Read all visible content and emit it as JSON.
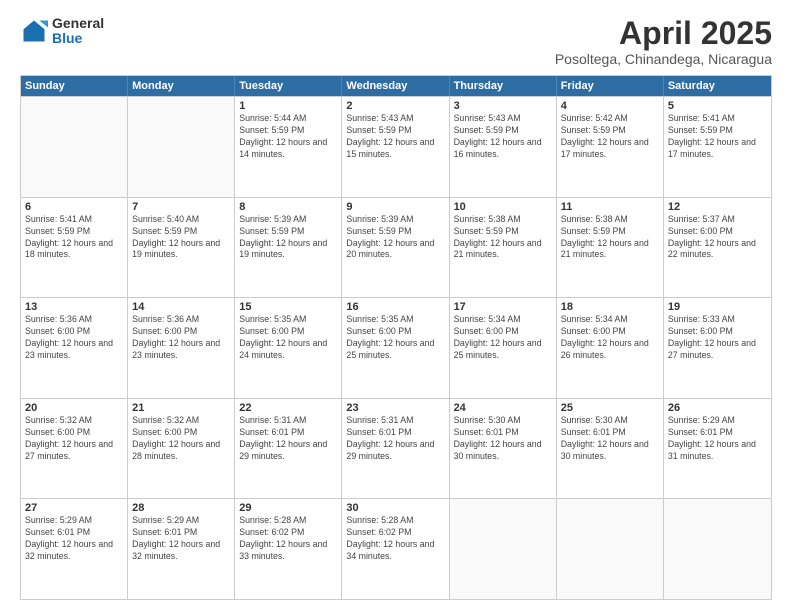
{
  "logo": {
    "general": "General",
    "blue": "Blue"
  },
  "header": {
    "month": "April 2025",
    "location": "Posoltega, Chinandega, Nicaragua"
  },
  "days_of_week": [
    "Sunday",
    "Monday",
    "Tuesday",
    "Wednesday",
    "Thursday",
    "Friday",
    "Saturday"
  ],
  "weeks": [
    [
      {
        "day": "",
        "empty": true
      },
      {
        "day": "",
        "empty": true
      },
      {
        "day": "1",
        "sunrise": "5:44 AM",
        "sunset": "5:59 PM",
        "daylight": "12 hours and 14 minutes."
      },
      {
        "day": "2",
        "sunrise": "5:43 AM",
        "sunset": "5:59 PM",
        "daylight": "12 hours and 15 minutes."
      },
      {
        "day": "3",
        "sunrise": "5:43 AM",
        "sunset": "5:59 PM",
        "daylight": "12 hours and 16 minutes."
      },
      {
        "day": "4",
        "sunrise": "5:42 AM",
        "sunset": "5:59 PM",
        "daylight": "12 hours and 17 minutes."
      },
      {
        "day": "5",
        "sunrise": "5:41 AM",
        "sunset": "5:59 PM",
        "daylight": "12 hours and 17 minutes."
      }
    ],
    [
      {
        "day": "6",
        "sunrise": "5:41 AM",
        "sunset": "5:59 PM",
        "daylight": "12 hours and 18 minutes."
      },
      {
        "day": "7",
        "sunrise": "5:40 AM",
        "sunset": "5:59 PM",
        "daylight": "12 hours and 19 minutes."
      },
      {
        "day": "8",
        "sunrise": "5:39 AM",
        "sunset": "5:59 PM",
        "daylight": "12 hours and 19 minutes."
      },
      {
        "day": "9",
        "sunrise": "5:39 AM",
        "sunset": "5:59 PM",
        "daylight": "12 hours and 20 minutes."
      },
      {
        "day": "10",
        "sunrise": "5:38 AM",
        "sunset": "5:59 PM",
        "daylight": "12 hours and 21 minutes."
      },
      {
        "day": "11",
        "sunrise": "5:38 AM",
        "sunset": "5:59 PM",
        "daylight": "12 hours and 21 minutes."
      },
      {
        "day": "12",
        "sunrise": "5:37 AM",
        "sunset": "6:00 PM",
        "daylight": "12 hours and 22 minutes."
      }
    ],
    [
      {
        "day": "13",
        "sunrise": "5:36 AM",
        "sunset": "6:00 PM",
        "daylight": "12 hours and 23 minutes."
      },
      {
        "day": "14",
        "sunrise": "5:36 AM",
        "sunset": "6:00 PM",
        "daylight": "12 hours and 23 minutes."
      },
      {
        "day": "15",
        "sunrise": "5:35 AM",
        "sunset": "6:00 PM",
        "daylight": "12 hours and 24 minutes."
      },
      {
        "day": "16",
        "sunrise": "5:35 AM",
        "sunset": "6:00 PM",
        "daylight": "12 hours and 25 minutes."
      },
      {
        "day": "17",
        "sunrise": "5:34 AM",
        "sunset": "6:00 PM",
        "daylight": "12 hours and 25 minutes."
      },
      {
        "day": "18",
        "sunrise": "5:34 AM",
        "sunset": "6:00 PM",
        "daylight": "12 hours and 26 minutes."
      },
      {
        "day": "19",
        "sunrise": "5:33 AM",
        "sunset": "6:00 PM",
        "daylight": "12 hours and 27 minutes."
      }
    ],
    [
      {
        "day": "20",
        "sunrise": "5:32 AM",
        "sunset": "6:00 PM",
        "daylight": "12 hours and 27 minutes."
      },
      {
        "day": "21",
        "sunrise": "5:32 AM",
        "sunset": "6:00 PM",
        "daylight": "12 hours and 28 minutes."
      },
      {
        "day": "22",
        "sunrise": "5:31 AM",
        "sunset": "6:01 PM",
        "daylight": "12 hours and 29 minutes."
      },
      {
        "day": "23",
        "sunrise": "5:31 AM",
        "sunset": "6:01 PM",
        "daylight": "12 hours and 29 minutes."
      },
      {
        "day": "24",
        "sunrise": "5:30 AM",
        "sunset": "6:01 PM",
        "daylight": "12 hours and 30 minutes."
      },
      {
        "day": "25",
        "sunrise": "5:30 AM",
        "sunset": "6:01 PM",
        "daylight": "12 hours and 30 minutes."
      },
      {
        "day": "26",
        "sunrise": "5:29 AM",
        "sunset": "6:01 PM",
        "daylight": "12 hours and 31 minutes."
      }
    ],
    [
      {
        "day": "27",
        "sunrise": "5:29 AM",
        "sunset": "6:01 PM",
        "daylight": "12 hours and 32 minutes."
      },
      {
        "day": "28",
        "sunrise": "5:29 AM",
        "sunset": "6:01 PM",
        "daylight": "12 hours and 32 minutes."
      },
      {
        "day": "29",
        "sunrise": "5:28 AM",
        "sunset": "6:02 PM",
        "daylight": "12 hours and 33 minutes."
      },
      {
        "day": "30",
        "sunrise": "5:28 AM",
        "sunset": "6:02 PM",
        "daylight": "12 hours and 34 minutes."
      },
      {
        "day": "",
        "empty": true
      },
      {
        "day": "",
        "empty": true
      },
      {
        "day": "",
        "empty": true
      }
    ]
  ]
}
